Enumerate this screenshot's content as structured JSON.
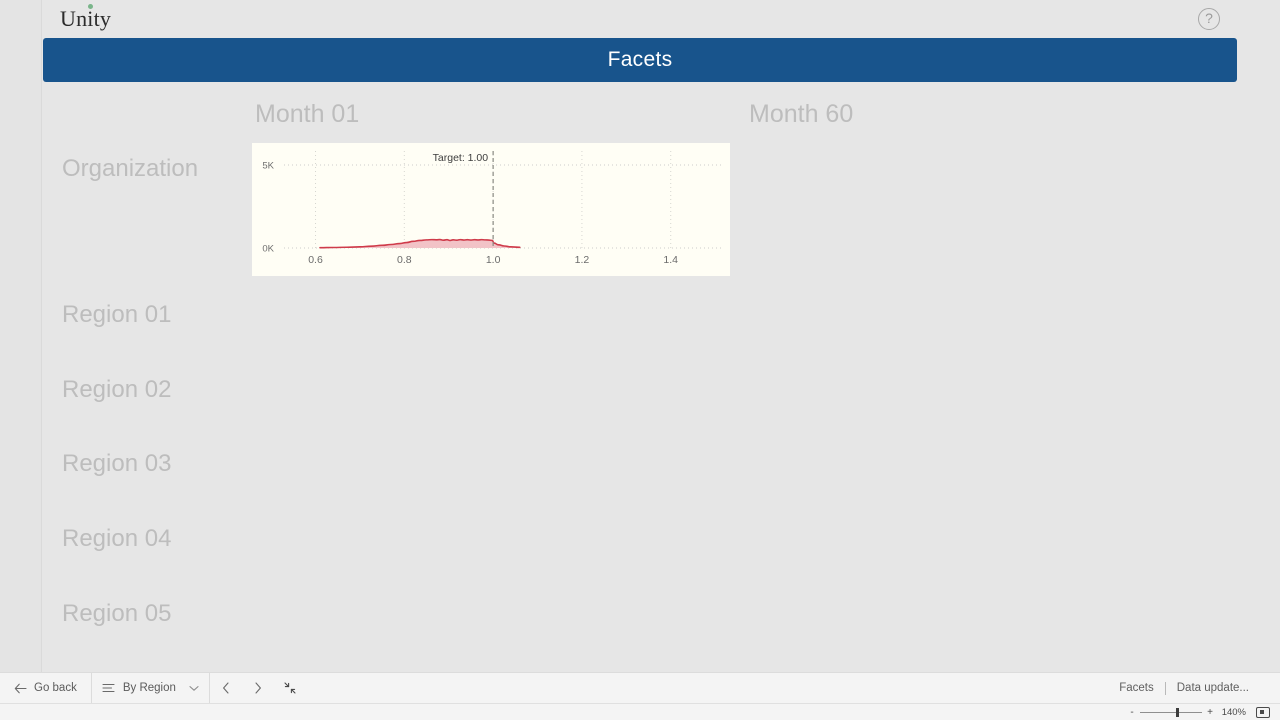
{
  "window": {
    "app_title_prefix": "Un",
    "app_title_dotted": "i",
    "app_title_suffix": "ty",
    "app_title_full": "Unity",
    "help_glyph": "?"
  },
  "banner": {
    "title": "Facets"
  },
  "grid": {
    "column_headers": [
      "Month 01",
      "Month 60"
    ],
    "row_labels": [
      "Organization",
      "Region 01",
      "Region 02",
      "Region 03",
      "Region 04",
      "Region 05"
    ]
  },
  "toolbar": {
    "go_back_label": "Go back",
    "sort_label": "By Region",
    "back_arrow_glyph": "←",
    "prev_glyph": "‹",
    "next_glyph": "›",
    "right_items": {
      "facets_label": "Facets",
      "data_update_label": "Data update..."
    }
  },
  "statusbar": {
    "zoom_minus": "-",
    "zoom_plus": "+",
    "zoom_percent": "140%"
  },
  "chart_data": {
    "type": "area",
    "title": "",
    "subtitle": "",
    "xlabel": "",
    "ylabel": "",
    "grid": true,
    "legend": false,
    "xlim": [
      0.52,
      1.52
    ],
    "ylim": [
      0,
      5000
    ],
    "xticks": [
      0.6,
      0.8,
      1.0,
      1.2,
      1.4
    ],
    "xticklabels": [
      "0.6",
      "0.8",
      "1.0",
      "1.2",
      "1.4"
    ],
    "yticks": [
      0,
      5000
    ],
    "yticklabels": [
      "0K",
      "5K"
    ],
    "annotations": [
      {
        "label": "Target: 1.00",
        "type": "vline",
        "x": 1.0,
        "style": "dashed"
      }
    ],
    "series": [
      {
        "name": "Organization / Month 01",
        "color": "#cf3b4a",
        "fill": "#f2c3c7",
        "x": [
          0.61,
          0.64,
          0.67,
          0.7,
          0.725,
          0.75,
          0.77,
          0.79,
          0.805,
          0.82,
          0.835,
          0.85,
          0.862,
          0.872,
          0.88,
          0.888,
          0.896,
          0.903,
          0.91,
          0.918,
          0.926,
          0.934,
          0.942,
          0.95,
          0.958,
          0.966,
          0.974,
          0.982,
          0.99,
          0.998,
          1.002,
          1.012,
          1.025,
          1.04,
          1.06
        ],
        "y": [
          20,
          30,
          45,
          70,
          110,
          160,
          210,
          270,
          330,
          400,
          455,
          490,
          505,
          495,
          510,
          470,
          500,
          455,
          495,
          470,
          505,
          480,
          500,
          475,
          500,
          485,
          505,
          490,
          480,
          455,
          300,
          190,
          120,
          70,
          40
        ]
      }
    ]
  }
}
